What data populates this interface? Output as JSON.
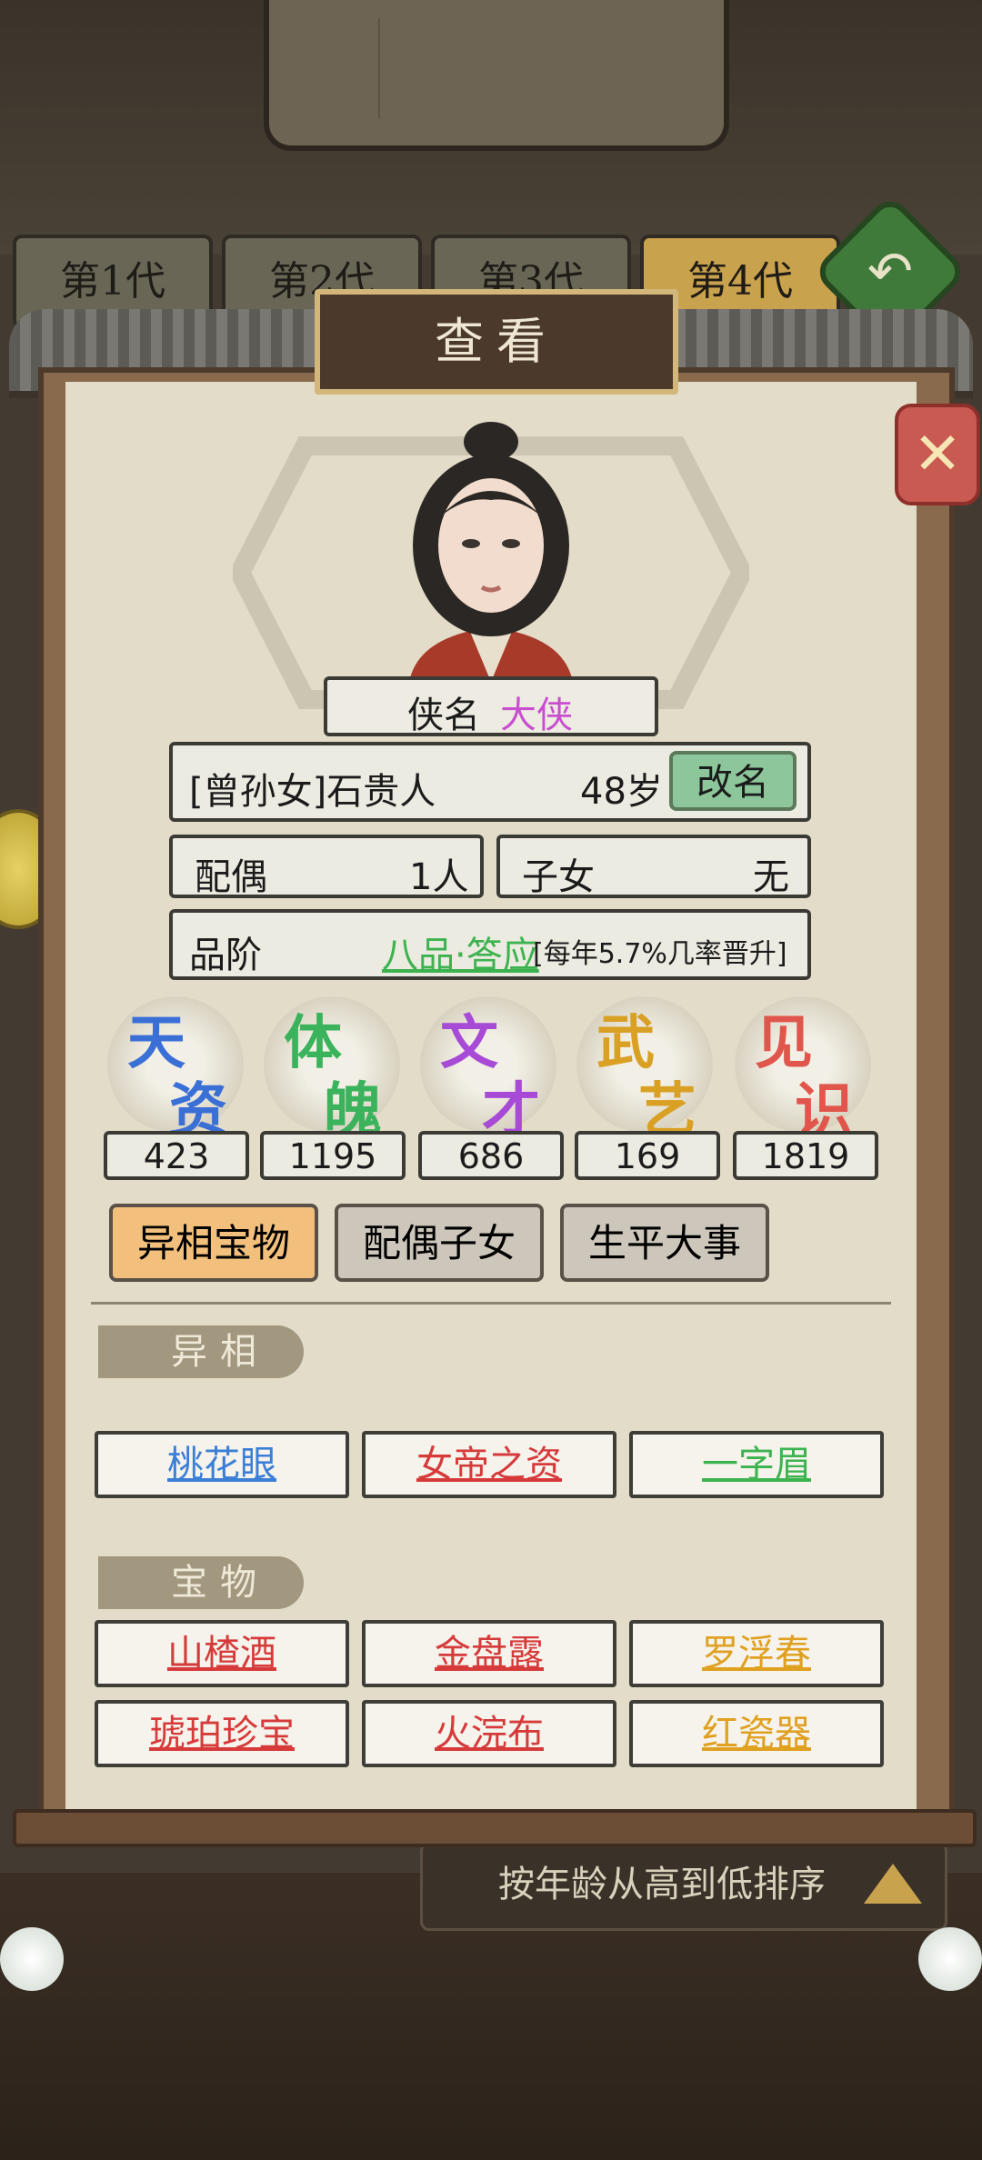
{
  "tabs": [
    {
      "label": "第1代",
      "active": false
    },
    {
      "label": "第2代",
      "active": false
    },
    {
      "label": "第3代",
      "active": false
    },
    {
      "label": "第4代",
      "active": true
    }
  ],
  "dialog": {
    "title": "查看"
  },
  "character": {
    "title_label": "侠名",
    "title_value": "大侠",
    "relation_name": "[曾孙女]石贵人",
    "age": "48岁",
    "rename_label": "改名",
    "spouse_label": "配偶",
    "spouse_value": "1人",
    "children_label": "子女",
    "children_value": "无",
    "rank_label": "品阶",
    "rank_value": "八品·答应",
    "rank_note": "[每年5.7%几率晋升]"
  },
  "stats": [
    {
      "label": "天资",
      "value": "423",
      "color": "#3a6fd6"
    },
    {
      "label": "体魄",
      "value": "1195",
      "color": "#3bb35c"
    },
    {
      "label": "文才",
      "value": "686",
      "color": "#a74ad6"
    },
    {
      "label": "武艺",
      "value": "169",
      "color": "#d9a024"
    },
    {
      "label": "见识",
      "value": "1819",
      "color": "#e0554c"
    }
  ],
  "detail_tabs": [
    {
      "label": "异相宝物",
      "active": true
    },
    {
      "label": "配偶子女",
      "active": false
    },
    {
      "label": "生平大事",
      "active": false
    }
  ],
  "traits": {
    "header": "异相",
    "items": [
      {
        "label": "桃花眼",
        "color": "#3c7fd6"
      },
      {
        "label": "女帝之资",
        "color": "#d63a3a"
      },
      {
        "label": "一字眉",
        "color": "#3db34f"
      }
    ]
  },
  "treasures": {
    "header": "宝物",
    "items": [
      {
        "label": "山楂酒",
        "color": "#d63a3a"
      },
      {
        "label": "金盘露",
        "color": "#d63a3a"
      },
      {
        "label": "罗浮春",
        "color": "#e0a020"
      },
      {
        "label": "琥珀珍宝",
        "color": "#d63a3a"
      },
      {
        "label": "火浣布",
        "color": "#d63a3a"
      },
      {
        "label": "红瓷器",
        "color": "#e0a020"
      }
    ]
  },
  "sort": {
    "label": "按年龄从高到低排序"
  },
  "colors": {
    "rank_value": "#3db34f",
    "title_value": "#c94fd1"
  }
}
